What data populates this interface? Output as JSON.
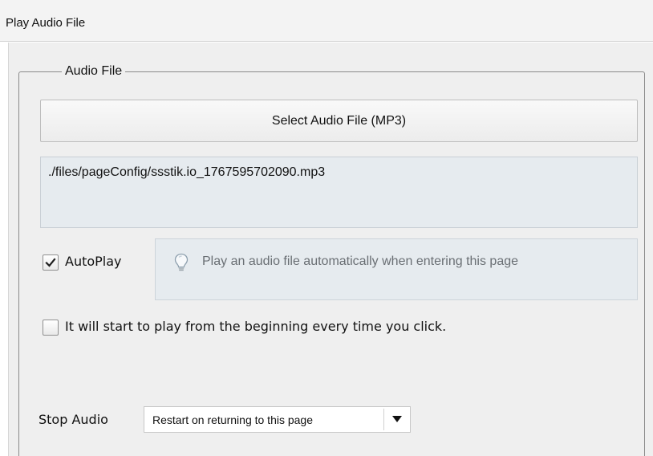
{
  "window": {
    "title": "Play Audio File"
  },
  "audio_group": {
    "legend": "Audio File",
    "select_button_label": "Select Audio File (MP3)",
    "file_path": "./files/pageConfig/ssstik.io_1767595702090.mp3"
  },
  "autoplay": {
    "label": "AutoPlay",
    "checked": true,
    "hint_icon": "lightbulb-icon",
    "hint_text": "Play an audio file automatically when entering this page"
  },
  "restart_option": {
    "label": "It will start to play from the beginning every time you click.",
    "checked": false
  },
  "stop_audio": {
    "label": "Stop Audio",
    "selected": "Restart on returning to this page",
    "arrow_icon": "triangle-down-icon"
  }
}
